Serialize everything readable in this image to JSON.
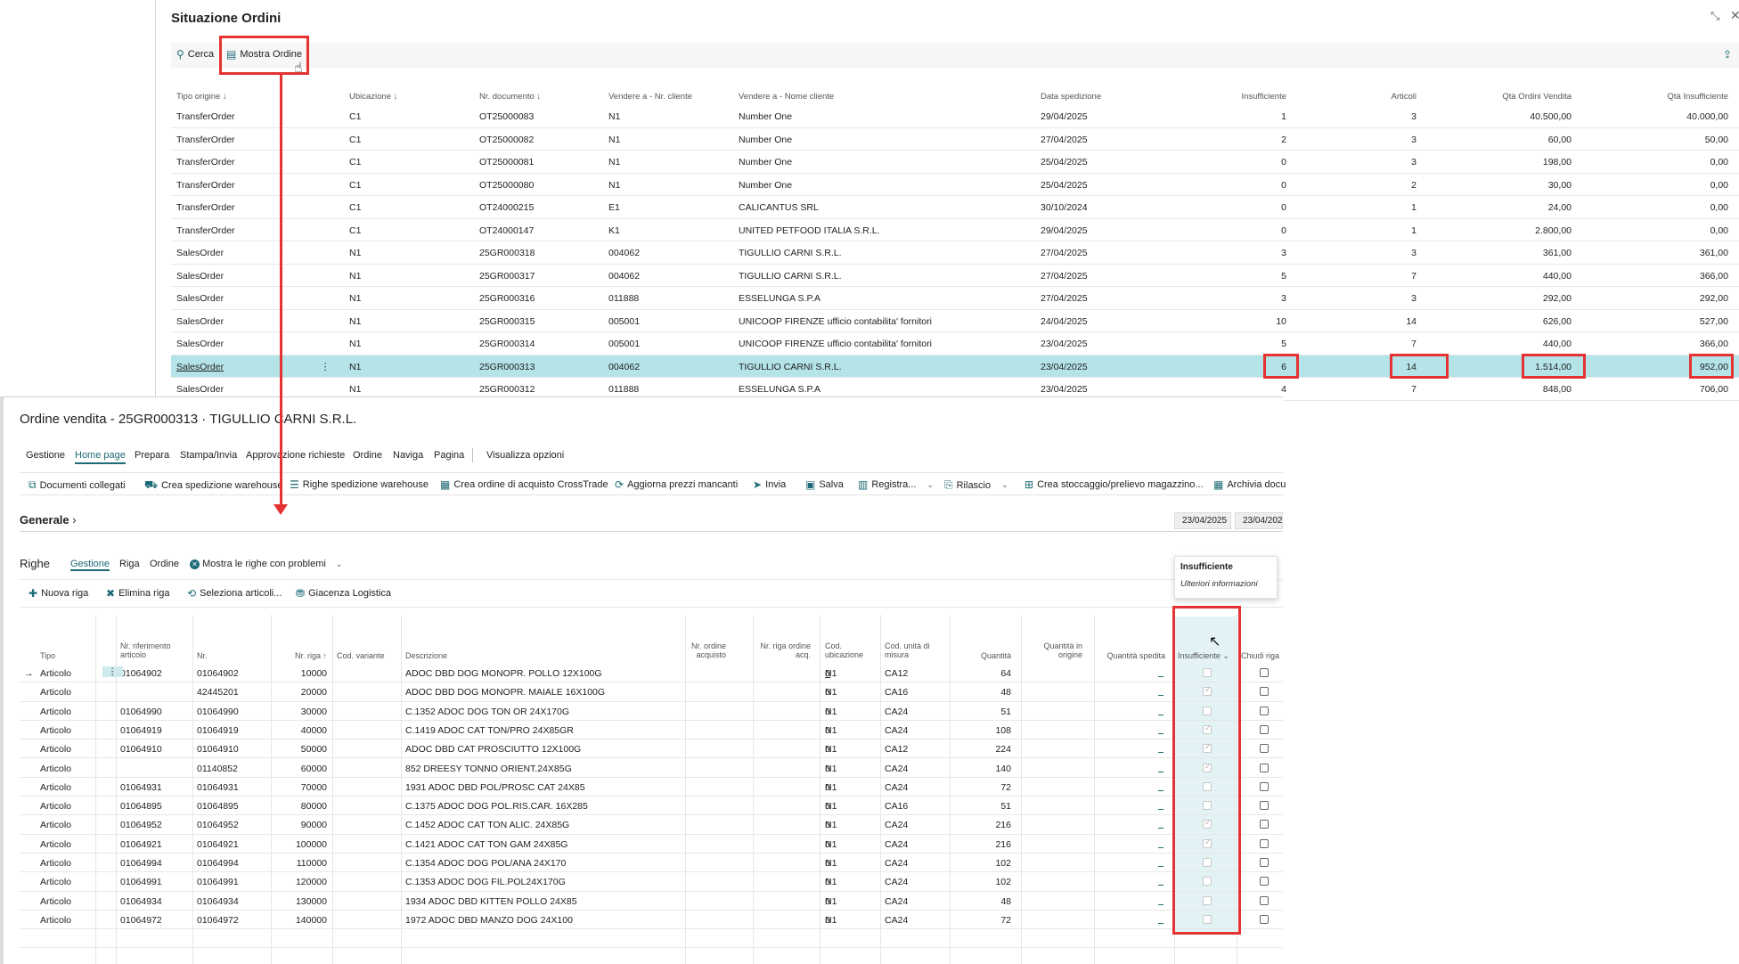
{
  "top": {
    "title": "Situazione Ordini",
    "toolbar": {
      "cerca": "Cerca",
      "mostra_ordine": "Mostra Ordine"
    },
    "headers": {
      "tipo": "Tipo origine ↓",
      "ubicazione": "Ubicazione ↓",
      "nr_documento": "Nr. documento ↓",
      "nr_cliente": "Vendere a - Nr. cliente",
      "nome_cliente": "Vendere a - Nome cliente",
      "data": "Data spedizione",
      "insufficiente": "Insufficiente",
      "articoli": "Articoli",
      "qta_ordini": "Qtà Ordini Vendita",
      "qta_insuff": "Qtà Insufficiente"
    },
    "rows": [
      {
        "tipo": "TransferOrder",
        "ub": "C1",
        "doc": "OT25000083",
        "ncl": "N1",
        "nome": "Number One",
        "data": "29/04/2025",
        "ins": "1",
        "art": "3",
        "qov": "40.500,00",
        "qi": "40.000,00"
      },
      {
        "tipo": "TransferOrder",
        "ub": "C1",
        "doc": "OT25000082",
        "ncl": "N1",
        "nome": "Number One",
        "data": "27/04/2025",
        "ins": "2",
        "art": "3",
        "qov": "60,00",
        "qi": "50,00"
      },
      {
        "tipo": "TransferOrder",
        "ub": "C1",
        "doc": "OT25000081",
        "ncl": "N1",
        "nome": "Number One",
        "data": "25/04/2025",
        "ins": "0",
        "art": "3",
        "qov": "198,00",
        "qi": "0,00"
      },
      {
        "tipo": "TransferOrder",
        "ub": "C1",
        "doc": "OT25000080",
        "ncl": "N1",
        "nome": "Number One",
        "data": "25/04/2025",
        "ins": "0",
        "art": "2",
        "qov": "30,00",
        "qi": "0,00"
      },
      {
        "tipo": "TransferOrder",
        "ub": "C1",
        "doc": "OT24000215",
        "ncl": "E1",
        "nome": "CALICANTUS SRL",
        "data": "30/10/2024",
        "ins": "0",
        "art": "1",
        "qov": "24,00",
        "qi": "0,00"
      },
      {
        "tipo": "TransferOrder",
        "ub": "C1",
        "doc": "OT24000147",
        "ncl": "K1",
        "nome": "UNITED PETFOOD ITALIA S.R.L.",
        "data": "29/04/2025",
        "ins": "0",
        "art": "1",
        "qov": "2.800,00",
        "qi": "0,00"
      },
      {
        "tipo": "SalesOrder",
        "ub": "N1",
        "doc": "25GR000318",
        "ncl": "004062",
        "nome": "TIGULLIO CARNI S.R.L.",
        "data": "27/04/2025",
        "ins": "3",
        "art": "3",
        "qov": "361,00",
        "qi": "361,00"
      },
      {
        "tipo": "SalesOrder",
        "ub": "N1",
        "doc": "25GR000317",
        "ncl": "004062",
        "nome": "TIGULLIO CARNI S.R.L.",
        "data": "27/04/2025",
        "ins": "5",
        "art": "7",
        "qov": "440,00",
        "qi": "366,00"
      },
      {
        "tipo": "SalesOrder",
        "ub": "N1",
        "doc": "25GR000316",
        "ncl": "011888",
        "nome": "ESSELUNGA S.P.A",
        "data": "27/04/2025",
        "ins": "3",
        "art": "3",
        "qov": "292,00",
        "qi": "292,00"
      },
      {
        "tipo": "SalesOrder",
        "ub": "N1",
        "doc": "25GR000315",
        "ncl": "005001",
        "nome": "UNICOOP FIRENZE ufficio contabilita' fornitori",
        "data": "24/04/2025",
        "ins": "10",
        "art": "14",
        "qov": "626,00",
        "qi": "527,00"
      },
      {
        "tipo": "SalesOrder",
        "ub": "N1",
        "doc": "25GR000314",
        "ncl": "005001",
        "nome": "UNICOOP FIRENZE ufficio contabilita' fornitori",
        "data": "23/04/2025",
        "ins": "5",
        "art": "7",
        "qov": "440,00",
        "qi": "366,00"
      },
      {
        "tipo": "SalesOrder",
        "ub": "N1",
        "doc": "25GR000313",
        "ncl": "004062",
        "nome": "TIGULLIO CARNI S.R.L.",
        "data": "23/04/2025",
        "ins": "6",
        "art": "14",
        "qov": "1.514,00",
        "qi": "952,00"
      },
      {
        "tipo": "SalesOrder",
        "ub": "N1",
        "doc": "25GR000312",
        "ncl": "011888",
        "nome": "ESSELUNGA S.P.A",
        "data": "23/04/2025",
        "ins": "4",
        "art": "7",
        "qov": "848,00",
        "qi": "706,00"
      }
    ]
  },
  "bottom": {
    "title": "Ordine vendita - 25GR000313 · TIGULLIO CARNI S.R.L.",
    "menu": [
      "Gestione",
      "Home page",
      "Prepara",
      "Stampa/Invia",
      "Approvazione richieste",
      "Ordine",
      "Naviga",
      "Pagina",
      "Visualizza opzioni"
    ],
    "toolbar": {
      "documenti": "Documenti collegati",
      "crea_sped": "Crea spedizione warehouse",
      "righe_sped": "Righe spedizione warehouse",
      "crea_acq": "Crea ordine di acquisto CrossTrade",
      "aggiorna": "Aggiorna prezzi mancanti",
      "invia": "Invia",
      "salva": "Salva",
      "registra": "Registra...",
      "rilascio": "Rilascio",
      "stoccaggio": "Crea stoccaggio/prelievo magazzino...",
      "archivia": "Archivia docu"
    },
    "generale": "Generale",
    "dates": [
      "23/04/2025",
      "23/04/202"
    ],
    "righe": {
      "title": "Righe",
      "tabs": [
        "Gestione",
        "Riga",
        "Ordine"
      ],
      "problemi": "Mostra le righe con problemi",
      "nuova": "Nuova riga",
      "elimina": "Elimina riga",
      "seleziona": "Seleziona articoli...",
      "giacenza": "Giacenza Logistica"
    },
    "tooltip": {
      "title": "Insufficiente",
      "link": "Ulteriori informazioni"
    },
    "headers": {
      "tipo": "Tipo",
      "nr_rif": [
        "Nr. riferimento",
        "articolo"
      ],
      "nr": "Nr.",
      "nr_riga": "Nr. riga ↑",
      "variante": "Cod. variante",
      "descr": "Descrizione",
      "nr_ord_acq": [
        "Nr. ordine",
        "acquisto"
      ],
      "nr_riga_acq": [
        "Nr. riga ordine",
        "acq."
      ],
      "cod_ub": [
        "Cod.",
        "ubicazione"
      ],
      "cod_um": [
        "Cod. unità di",
        "misura"
      ],
      "qta": "Quantità",
      "qta_orig": [
        "Quantità in",
        "origine"
      ],
      "qta_sped": "Quantità spedita",
      "insuff": "Insufficiente",
      "chiudi": "Chiudi riga"
    },
    "rows": [
      {
        "tipo": "Articolo",
        "rif": "01064902",
        "nr": "01064902",
        "riga": "10000",
        "descr": "ADOC DBD DOG MONOPR. POLLO 12X100G",
        "acq": "0",
        "ub": "N1",
        "um": "CA12",
        "qta": "64",
        "ins": false
      },
      {
        "tipo": "Articolo",
        "rif": "",
        "nr": "42445201",
        "riga": "20000",
        "descr": "ADOC DBD DOG MONOPR. MAIALE 16X100G",
        "acq": "0",
        "ub": "N1",
        "um": "CA16",
        "qta": "48",
        "ins": true
      },
      {
        "tipo": "Articolo",
        "rif": "01064990",
        "nr": "01064990",
        "riga": "30000",
        "descr": "C.1352 ADOC DOG TON OR 24X170G",
        "acq": "0",
        "ub": "N1",
        "um": "CA24",
        "qta": "51",
        "ins": false
      },
      {
        "tipo": "Articolo",
        "rif": "01064919",
        "nr": "01064919",
        "riga": "40000",
        "descr": "C.1419 ADOC CAT TON/PRO 24X85GR",
        "acq": "0",
        "ub": "N1",
        "um": "CA24",
        "qta": "108",
        "ins": true
      },
      {
        "tipo": "Articolo",
        "rif": "01064910",
        "nr": "01064910",
        "riga": "50000",
        "descr": "ADOC DBD CAT PROSCIUTTO 12X100G",
        "acq": "0",
        "ub": "N1",
        "um": "CA12",
        "qta": "224",
        "ins": true
      },
      {
        "tipo": "Articolo",
        "rif": "",
        "nr": "01140852",
        "riga": "60000",
        "descr": "852 DREESY TONNO ORIENT.24X85G",
        "acq": "0",
        "ub": "N1",
        "um": "CA24",
        "qta": "140",
        "ins": true
      },
      {
        "tipo": "Articolo",
        "rif": "01064931",
        "nr": "01064931",
        "riga": "70000",
        "descr": "1931 ADOC DBD POL/PROSC CAT 24X85",
        "acq": "0",
        "ub": "N1",
        "um": "CA24",
        "qta": "72",
        "ins": false
      },
      {
        "tipo": "Articolo",
        "rif": "01064895",
        "nr": "01064895",
        "riga": "80000",
        "descr": "C.1375 ADOC DOG POL.RIS.CAR. 16X285",
        "acq": "0",
        "ub": "N1",
        "um": "CA16",
        "qta": "51",
        "ins": false
      },
      {
        "tipo": "Articolo",
        "rif": "01064952",
        "nr": "01064952",
        "riga": "90000",
        "descr": "C.1452 ADOC CAT TON ALIC. 24X85G",
        "acq": "0",
        "ub": "N1",
        "um": "CA24",
        "qta": "216",
        "ins": true
      },
      {
        "tipo": "Articolo",
        "rif": "01064921",
        "nr": "01064921",
        "riga": "100000",
        "descr": "C.1421 ADOC CAT TON GAM 24X85G",
        "acq": "0",
        "ub": "N1",
        "um": "CA24",
        "qta": "216",
        "ins": true
      },
      {
        "tipo": "Articolo",
        "rif": "01064994",
        "nr": "01064994",
        "riga": "110000",
        "descr": "C.1354 ADOC DOG POL/ANA 24X170",
        "acq": "0",
        "ub": "N1",
        "um": "CA24",
        "qta": "102",
        "ins": false
      },
      {
        "tipo": "Articolo",
        "rif": "01064991",
        "nr": "01064991",
        "riga": "120000",
        "descr": "C.1353 ADOC DOG FIL.POL24X170G",
        "acq": "0",
        "ub": "N1",
        "um": "CA24",
        "qta": "102",
        "ins": false
      },
      {
        "tipo": "Articolo",
        "rif": "01064934",
        "nr": "01064934",
        "riga": "130000",
        "descr": "1934 ADOC DBD KITTEN POLLO 24X85",
        "acq": "0",
        "ub": "N1",
        "um": "CA24",
        "qta": "48",
        "ins": false
      },
      {
        "tipo": "Articolo",
        "rif": "01064972",
        "nr": "01064972",
        "riga": "140000",
        "descr": "1972 ADOC DBD MANZO DOG 24X100",
        "acq": "0",
        "ub": "N1",
        "um": "CA24",
        "qta": "72",
        "ins": false
      }
    ]
  },
  "colors": {
    "accent": "#1e6b77",
    "highlight": "#e53333",
    "selected_row": "#b4e3e8"
  }
}
